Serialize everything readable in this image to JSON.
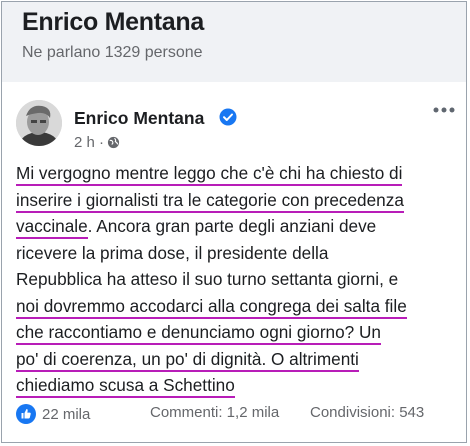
{
  "page": {
    "title": "Enrico Mentana",
    "subtitle": "Ne parlano 1329 persone"
  },
  "post": {
    "author": "Enrico Mentana",
    "time": "2 h ·",
    "lines": [
      "Mi vergogno mentre leggo che c'è chi ha chiesto di",
      "inserire i giornalisti tra le categorie con precedenza",
      "vaccinale",
      ". Ancora gran parte degli anziani deve",
      "ricevere la prima dose, il presidente della",
      "Repubblica ha atteso il suo turno settanta giorni, e",
      "noi dovremmo accodarci alla congrega dei salta file",
      "che raccontiamo e denunciamo ogni giorno? Un",
      "po' di coerenza, un po' di dignità. O altrimenti",
      "chiediamo scusa a Schettino"
    ]
  },
  "footer": {
    "likes": "22 mila",
    "comments": "Commenti: 1,2 mila",
    "shares": "Condivisioni: 543"
  },
  "colors": {
    "highlight": "#b81db8",
    "verified": "#1877f2",
    "like": "#1877f2"
  },
  "icons": [
    "verified-badge-icon",
    "globe-icon",
    "more-options-icon",
    "like-icon"
  ]
}
